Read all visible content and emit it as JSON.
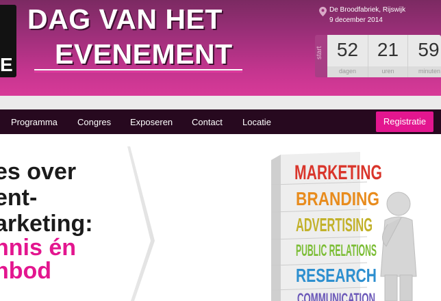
{
  "header": {
    "logo_letter": "E",
    "title_line1": "DAG VAN HET",
    "title_line2": "EVENEMENT",
    "location": "De Broodfabriek, Rijswijk",
    "date": "9 december 2014",
    "countdown": {
      "start_label": "start",
      "cells": [
        {
          "value": "52",
          "label": "dagen"
        },
        {
          "value": "21",
          "label": "uren"
        },
        {
          "value": "59",
          "label": "minuten"
        }
      ]
    }
  },
  "nav": {
    "items": [
      "Programma",
      "Congres",
      "Exposeren",
      "Contact",
      "Locatie"
    ],
    "cta": "Registratie"
  },
  "hero": {
    "lines": [
      "es over",
      "ent-",
      "arketing:",
      "nnis én",
      "nbod"
    ]
  },
  "image": {
    "words": [
      "MARKETING",
      "BRANDING",
      "ADVERTISING",
      "PUBLIC RELATIONS",
      "RESEARCH",
      "COMMUNICATION"
    ]
  },
  "colors": {
    "header_top": "#7b2a62",
    "header_bottom": "#d83a98",
    "nav_bg": "#27091f",
    "accent": "#e3168f"
  }
}
